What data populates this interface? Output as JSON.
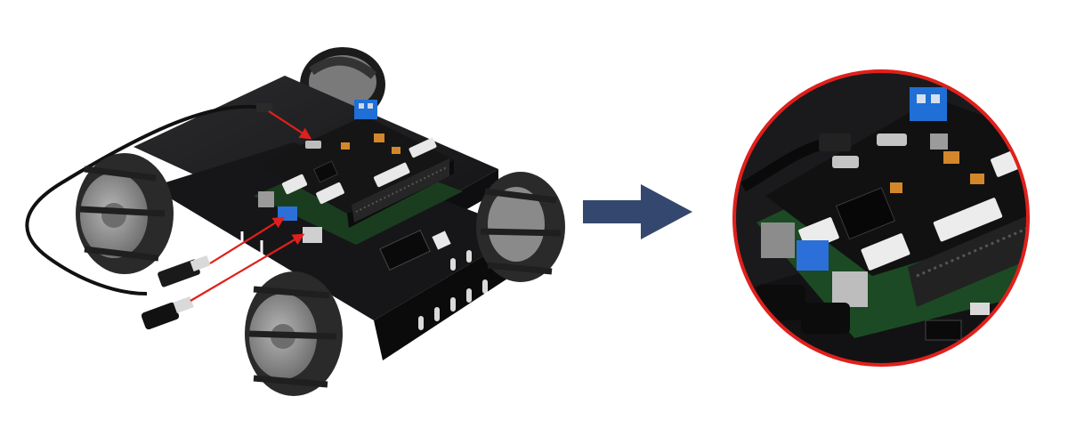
{
  "scene": {
    "description_visible_text": [],
    "colors": {
      "background": "#ffffff",
      "chassis": "#1c1c1e",
      "board": "#141414",
      "wheel_roller": "#2a2a2a",
      "wheel_hub": "#8f8f8f",
      "callout_arrow": "#e0201c",
      "flow_arrow": "#34476e",
      "magnifier_ring": "#e0201c",
      "terminal_block": "#1f6fd6",
      "usb_blue": "#2c6fd8"
    },
    "icons": {
      "flow_arrow": "right-arrow-icon",
      "callout": "red-pointer-arrow"
    }
  }
}
